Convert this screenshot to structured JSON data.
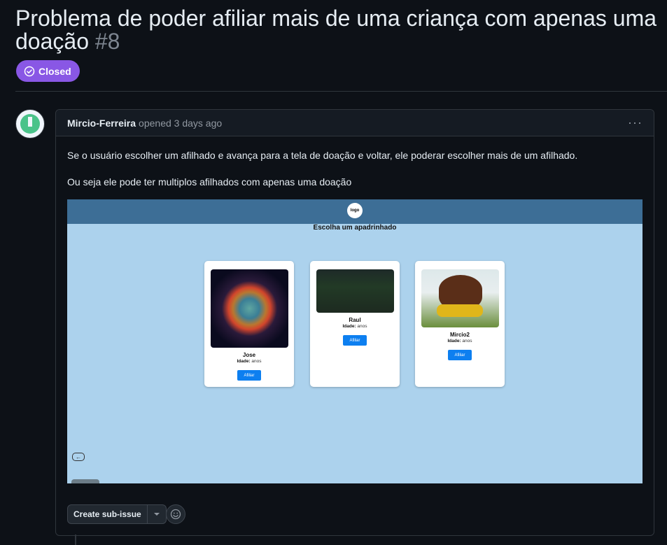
{
  "issue": {
    "title": "Problema de poder afiliar mais de uma criança com apenas uma doação",
    "number": "#8",
    "state": "Closed",
    "state_color": "#8957e5"
  },
  "comment": {
    "author": "Mircio-Ferreira",
    "meta": "opened 3 days ago",
    "menu_icon": "kebab-horizontal-icon",
    "paragraphs": [
      "Se o usuário escolher um afilhado e avança para a tela de doação e voltar, ele poderar escolher mais de um afilhado.",
      "Ou seja ele pode ter multiplos afilhados com apenas uma doação"
    ]
  },
  "screenshot": {
    "logo": "logo",
    "heading": "Escolha um apadrinhado",
    "age_label": "Idade:",
    "button_label": "Afiliar",
    "cards": [
      {
        "name": "Jose",
        "age_suffix": " anos"
      },
      {
        "name": "Raul",
        "age_suffix": " anos"
      },
      {
        "name": "Mircio2",
        "age_suffix": " anos"
      }
    ]
  },
  "actions": {
    "create_sub_issue": "Create sub-issue",
    "emoji_icon": "smiley-icon"
  }
}
